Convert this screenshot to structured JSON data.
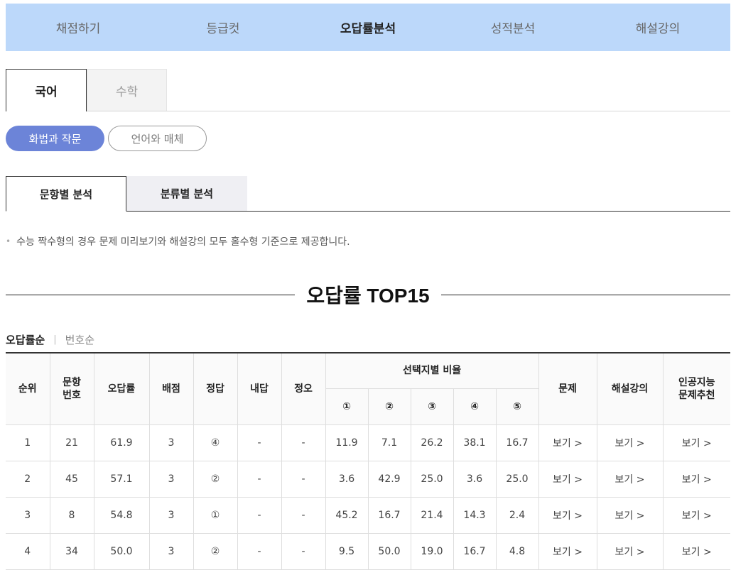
{
  "nav": {
    "items": [
      {
        "label": "채점하기"
      },
      {
        "label": "등급컷"
      },
      {
        "label": "오답률분석"
      },
      {
        "label": "성적분석"
      },
      {
        "label": "해설강의"
      }
    ]
  },
  "subjects": {
    "active": "국어",
    "inactive": "수학"
  },
  "electives": {
    "active": "화법과 작문",
    "inactive": "언어와 매체"
  },
  "analysis_tabs": {
    "active": "문항별 분석",
    "inactive": "분류별 분석"
  },
  "notice": "수능 짝수형의 경우 문제 미리보기와 해설강의 모두 홀수형 기준으로 제공합니다.",
  "section_title": "오답률 TOP15",
  "sort": {
    "active": "오답률순",
    "inactive": "번호순"
  },
  "table": {
    "headers": {
      "rank": "순위",
      "qnum": "문항\n번호",
      "error_rate": "오답률",
      "points": "배점",
      "answer": "정답",
      "my_answer": "내답",
      "correct": "정오",
      "choice_ratio": "선택지별 비율",
      "choices": [
        "①",
        "②",
        "③",
        "④",
        "⑤"
      ],
      "problem": "문제",
      "lecture": "해설강의",
      "ai": "인공지능\n문제추천"
    },
    "rows": [
      {
        "rank": "1",
        "qnum": "21",
        "rate": "61.9",
        "points": "3",
        "answer": "④",
        "mine": "-",
        "ox": "-",
        "c": [
          "11.9",
          "7.1",
          "26.2",
          "38.1",
          "16.7"
        ],
        "view1": "보기 >",
        "view2": "보기 >",
        "view3": "보기 >"
      },
      {
        "rank": "2",
        "qnum": "45",
        "rate": "57.1",
        "points": "3",
        "answer": "②",
        "mine": "-",
        "ox": "-",
        "c": [
          "3.6",
          "42.9",
          "25.0",
          "3.6",
          "25.0"
        ],
        "view1": "보기 >",
        "view2": "보기 >",
        "view3": "보기 >"
      },
      {
        "rank": "3",
        "qnum": "8",
        "rate": "54.8",
        "points": "3",
        "answer": "①",
        "mine": "-",
        "ox": "-",
        "c": [
          "45.2",
          "16.7",
          "21.4",
          "14.3",
          "2.4"
        ],
        "view1": "보기 >",
        "view2": "보기 >",
        "view3": "보기 >"
      },
      {
        "rank": "4",
        "qnum": "34",
        "rate": "50.0",
        "points": "3",
        "answer": "②",
        "mine": "-",
        "ox": "-",
        "c": [
          "9.5",
          "50.0",
          "19.0",
          "16.7",
          "4.8"
        ],
        "view1": "보기 >",
        "view2": "보기 >",
        "view3": "보기 >"
      }
    ]
  }
}
